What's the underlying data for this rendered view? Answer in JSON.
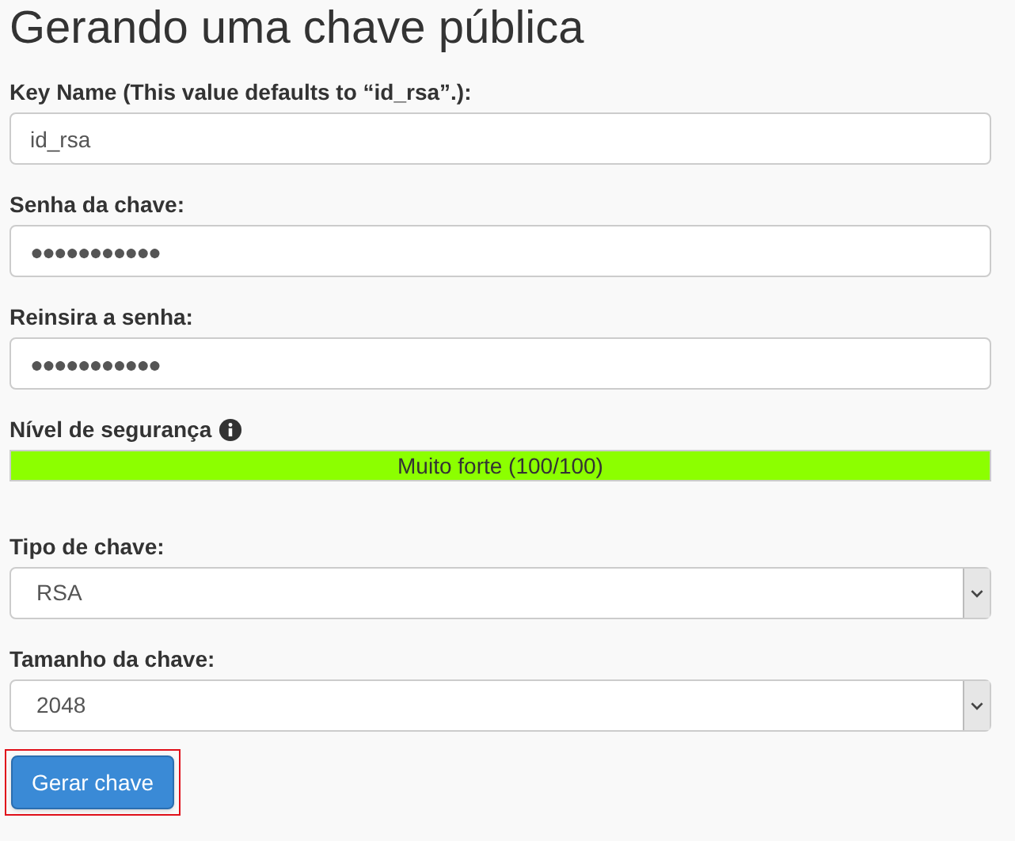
{
  "title": "Gerando uma chave pública",
  "fields": [
    {
      "kind": "text",
      "label": "Key Name (This value defaults to “id_rsa”.):",
      "value": "id_rsa"
    },
    {
      "kind": "password",
      "label": "Senha da chave:",
      "value": "●●●●●●●●●●●"
    },
    {
      "kind": "password",
      "label": "Reinsira a senha:",
      "value": "●●●●●●●●●●●"
    },
    {
      "kind": "meter",
      "label": "Nível de segurança",
      "info": true,
      "level": 1,
      "reading": "Muito forte (100/100)"
    },
    {
      "kind": "select",
      "label": "Tipo de chave:",
      "value": "RSA"
    },
    {
      "kind": "select",
      "label": "Tamanho da chave:",
      "value": "2048"
    }
  ],
  "button": {
    "label": "Gerar chave",
    "highlighted": true
  }
}
